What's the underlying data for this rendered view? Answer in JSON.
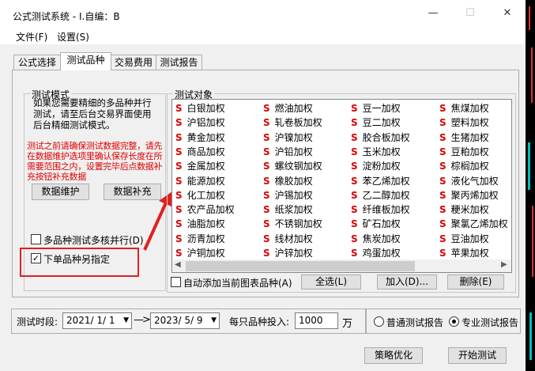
{
  "window": {
    "title": "公式测试系统 - I.自编：B",
    "minimize": "—",
    "maximize": "☐",
    "close": "✕"
  },
  "menu": [
    {
      "label": "文件(F)"
    },
    {
      "label": "设置(S)"
    }
  ],
  "tabs": [
    {
      "label": "公式选择",
      "active": false
    },
    {
      "label": "测试品种",
      "active": true
    },
    {
      "label": "交易费用",
      "active": false
    },
    {
      "label": "测试报告",
      "active": false
    }
  ],
  "test_mode": {
    "title": "测试模式",
    "description": "如果您需要精细的多品种并行测试，请至后台交易界面使用后台精细测试模式。",
    "warning": "测试之前请确保测试数据完整，请先在数据维护选项里确认保存长度在所需要范围之内，设置完毕后点数据补充按钮补充数据",
    "data_maintain_button": "数据维护",
    "data_supplement_button": "数据补充",
    "multicore_checkbox": {
      "label": "多品种测试多核并行(D)",
      "checked": false
    },
    "separate_checkbox": {
      "label": "下单品种另指定",
      "checked": true
    }
  },
  "objects": {
    "title": "测试对象",
    "prefix": "S",
    "columns": [
      [
        "白银加权",
        "沪铝加权",
        "黄金加权",
        "商品加权",
        "金属加权",
        "能源加权",
        "化工加权",
        "农产品加权",
        "油脂加权",
        "沥青加权",
        "沪铜加权"
      ],
      [
        "燃油加权",
        "轧卷板加权",
        "沪镍加权",
        "沪铅加权",
        "螺纹钢加权",
        "橡胶加权",
        "沪锡加权",
        "纸浆加权",
        "不锈钢加权",
        "线材加权",
        "沪锌加权"
      ],
      [
        "豆一加权",
        "豆二加权",
        "胶合板加权",
        "玉米加权",
        "淀粉加权",
        "苯乙烯加权",
        "乙二醇加权",
        "纤维板加权",
        "矿石加权",
        "焦炭加权",
        "鸡蛋加权"
      ],
      [
        "焦煤加权",
        "塑料加权",
        "生猪加权",
        "豆粕加权",
        "棕榈加权",
        "液化气加权",
        "聚丙烯加权",
        "粳米加权",
        "聚氯乙烯加权",
        "豆油加权",
        "苹果加权"
      ]
    ],
    "auto_add_checkbox": {
      "label": "自动添加当前图表品种(A)",
      "checked": false
    },
    "select_all_button": "全选(L)",
    "add_button": "加入(D)...",
    "delete_button": "删除(E)"
  },
  "bottom": {
    "period_label": "测试时段:",
    "start_date": "2021/ 1/ 1",
    "arrow": "—>",
    "end_date": "2023/ 5/ 9",
    "invest_label": "每只品种投入:",
    "invest_value": "1000",
    "unit": "万",
    "report_normal": {
      "label": "普通测试报告",
      "selected": false
    },
    "report_pro": {
      "label": "专业测试报告",
      "selected": true
    },
    "strategy_button": "策略优化",
    "start_button": "开始测试"
  },
  "colors": {
    "warning_text": "#e00000",
    "annotation_red": "#e02020",
    "stock_s": "#e00000"
  }
}
